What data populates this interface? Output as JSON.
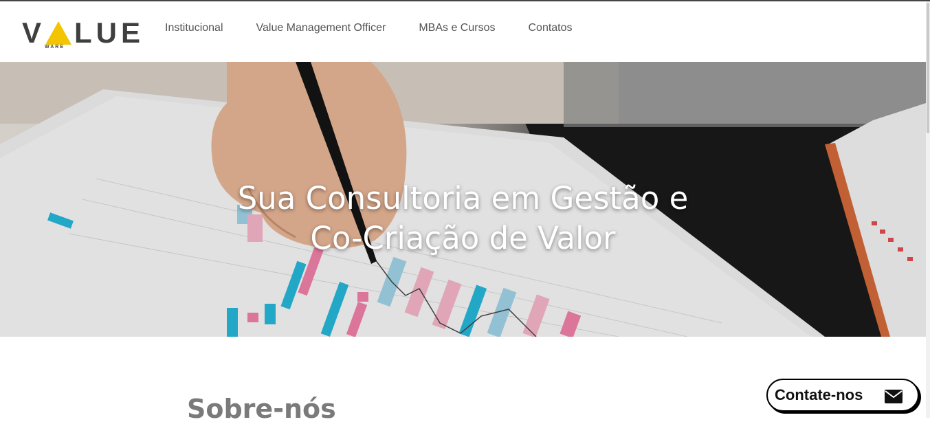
{
  "brand": {
    "logo_text": "VALUE",
    "logo_sub": "WARE",
    "accent": "#f2c500"
  },
  "nav": {
    "items": [
      {
        "label": "Institucional"
      },
      {
        "label": "Value Management Officer"
      },
      {
        "label": "MBAs e Cursos"
      },
      {
        "label": "Contatos"
      }
    ]
  },
  "hero": {
    "line1": "Sua Consultoria em Gestão e",
    "line2": "Co-Criação de Valor",
    "image": "desk-chart-pen-photo"
  },
  "about": {
    "title": "Sobre-nós"
  },
  "contact": {
    "label": "Contate-nos",
    "icon": "envelope-icon"
  }
}
